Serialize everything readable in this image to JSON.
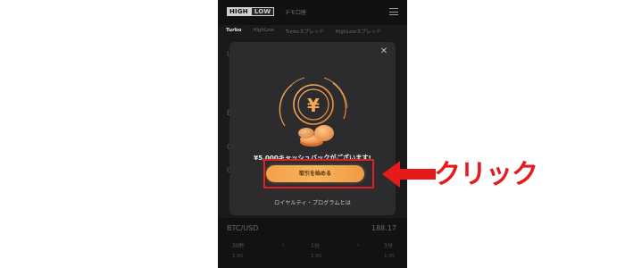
{
  "app": {
    "logo_high": "HIGH",
    "logo_low": "LOW",
    "header_text": "デモ口座"
  },
  "tabs": [
    {
      "label": "Turbo",
      "active": true
    },
    {
      "label": "HighLow",
      "active": false
    },
    {
      "label": "Turboスプレッド",
      "active": false
    },
    {
      "label": "HighLowスプレッド",
      "active": false
    }
  ],
  "background_rows": [
    "U",
    "E",
    "G",
    "C"
  ],
  "bottom_card": {
    "pair": "BTC/USD",
    "price": "188.17",
    "options": [
      {
        "label": "30秒",
        "sub": "1.95"
      },
      {
        "label": "1分",
        "sub": "1.95"
      },
      {
        "label": "3分",
        "sub": "1.95"
      }
    ]
  },
  "modal": {
    "close_symbol": "✕",
    "coin_symbol": "¥",
    "cashback_text": "¥5,000キャッシュバックがございます!",
    "cta_label": "取引を始める",
    "loyalty_link": "ロイヤルティ・プログラムとは"
  },
  "annotation": {
    "label": "クリック",
    "color": "#e51b1b"
  },
  "colors": {
    "cta_gradient_start": "#f7a04b",
    "cta_gradient_end": "#f29a44",
    "modal_bg": "#2c2c2e",
    "screen_bg": "#1a1a1b"
  }
}
